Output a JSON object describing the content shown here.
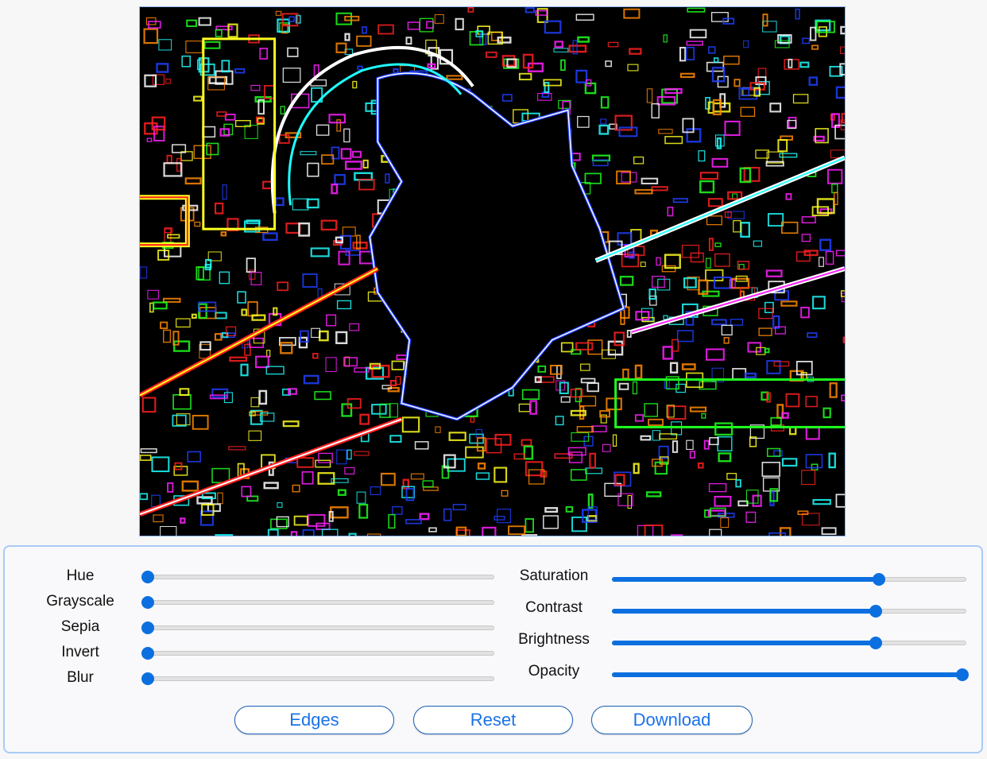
{
  "image": {
    "name": "edge-filtered-photo"
  },
  "left_sliders": [
    {
      "label": "Hue",
      "value": 0
    },
    {
      "label": "Grayscale",
      "value": 0
    },
    {
      "label": "Sepia",
      "value": 0
    },
    {
      "label": "Invert",
      "value": 0
    },
    {
      "label": "Blur",
      "value": 0
    }
  ],
  "right_sliders": [
    {
      "label": "Saturation",
      "value": 0.76
    },
    {
      "label": "Contrast",
      "value": 0.75
    },
    {
      "label": "Brightness",
      "value": 0.75
    },
    {
      "label": "Opacity",
      "value": 1.0
    }
  ],
  "buttons": {
    "edges": "Edges",
    "reset": "Reset",
    "download": "Download"
  },
  "colors": {
    "accent": "#0b6fe0",
    "button_text": "#1a73e8",
    "frame_border": "#8ab4f8",
    "panel_border": "#aacbf5"
  }
}
